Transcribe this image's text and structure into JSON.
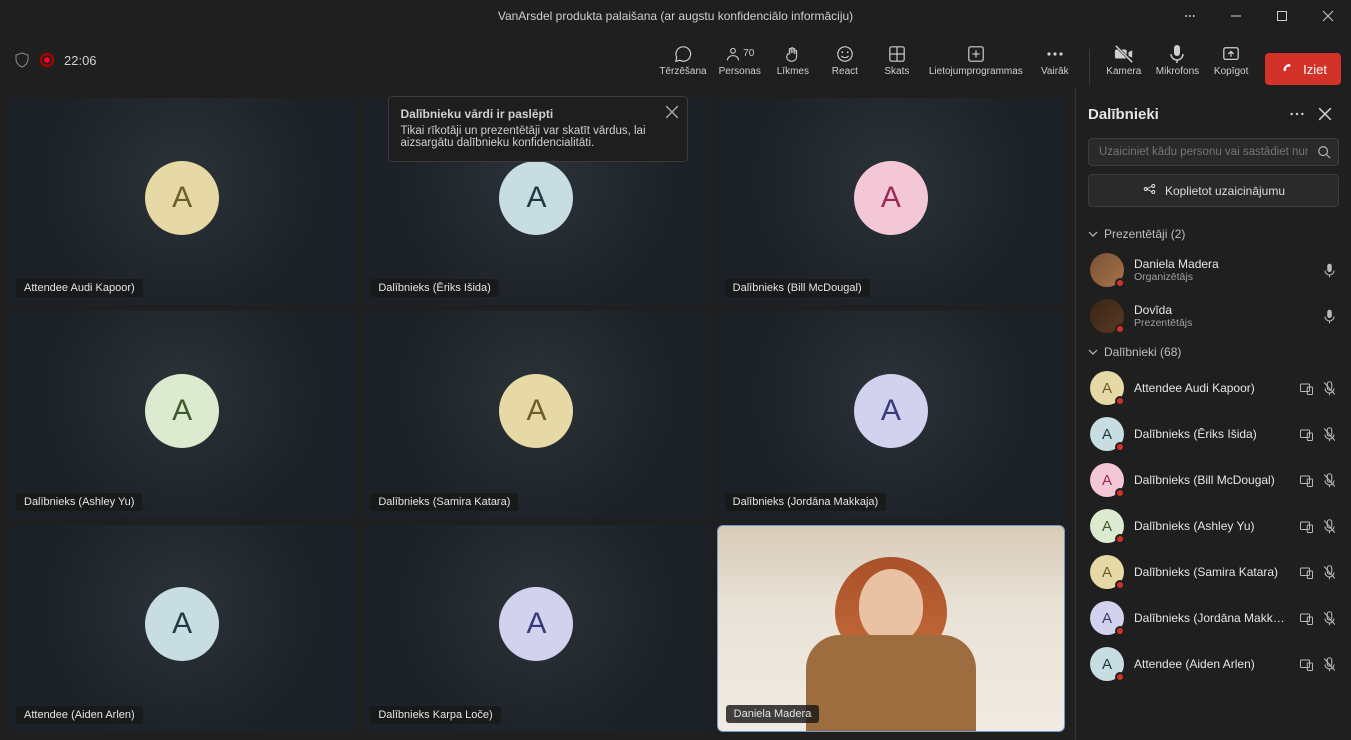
{
  "title": "VanArsdel produkta palaišana (ar augstu konfidenciālo informāciju)",
  "timer": "22:06",
  "toolbar": {
    "chat": "Tērzēšana",
    "people": "Personas",
    "people_count": "70",
    "raise": "Līkmes",
    "react": "React",
    "view": "Skats",
    "apps": "Lietojumprogrammas",
    "more": "Vairāk",
    "camera": "Kamera",
    "mic": "Mikrofons",
    "share": "Kopīgot",
    "leave": "Iziet"
  },
  "tooltip": {
    "title": "Dalībnieku vārdi ir paslēpti",
    "body": "Tikai rīkotāji un prezentētāji var skatīt vārdus, lai aizsargātu dalībnieku konfidencialitāti."
  },
  "tiles": [
    {
      "label": "Attendee Audi Kapoor)",
      "letter": "A",
      "bg": "#e7d9a5",
      "fg": "#6b5e2a"
    },
    {
      "label": "Dalībnieks (Ēriks Išida)",
      "letter": "A",
      "bg": "#c7dde1",
      "fg": "#1e3a42"
    },
    {
      "label": "Dalībnieks (Bill McDougal)",
      "letter": "A",
      "bg": "#f4c7d6",
      "fg": "#9a2a56"
    },
    {
      "label": "Dalībnieks (Ashley Yu)",
      "letter": "A",
      "bg": "#dcebd0",
      "fg": "#3e5a2a"
    },
    {
      "label": "Dalībnieks (Samira Katara)",
      "letter": "A",
      "bg": "#e7d9a5",
      "fg": "#6b5e2a"
    },
    {
      "label": "Dalībnieks (Jordāna Makkaja)",
      "letter": "A",
      "bg": "#d2d2ef",
      "fg": "#3a3a7a"
    },
    {
      "label": "Attendee (Aiden Arlen)",
      "letter": "A",
      "bg": "#c7dde1",
      "fg": "#1e3a42"
    },
    {
      "label": "Dalībnieks  Karpa Loče)",
      "letter": "A",
      "bg": "#d2d2ef",
      "fg": "#3a3a7a"
    }
  ],
  "video_tile": {
    "name": "Daniela Madera"
  },
  "panel": {
    "title": "Dalībnieki",
    "search_placeholder": "Uzaiciniet kādu personu vai sastādiet numuru",
    "share_invite": "Koplietot uzaicinājumu",
    "presenters_header": "Prezentētāji (2)",
    "presenters": [
      {
        "name": "Daniela Madera",
        "role": "Organizētājs"
      },
      {
        "name": "Dovīda",
        "role": "Prezentētājs"
      }
    ],
    "attendees_header": "Dalībnieki (68)",
    "attendees": [
      {
        "name": "Attendee Audi Kapoor)",
        "bg": "#e7d9a5",
        "fg": "#6b5e2a"
      },
      {
        "name": "Dalībnieks (Ēriks Išida)",
        "bg": "#c7dde1",
        "fg": "#1e3a42"
      },
      {
        "name": "Dalībnieks (Bill McDougal)",
        "bg": "#f4c7d6",
        "fg": "#9a2a56"
      },
      {
        "name": "Dalībnieks (Ashley Yu)",
        "bg": "#dcebd0",
        "fg": "#3e5a2a"
      },
      {
        "name": "Dalībnieks (Samira Katara)",
        "bg": "#e7d9a5",
        "fg": "#6b5e2a"
      },
      {
        "name": "Dalībnieks (Jordāna Makkaja)",
        "bg": "#d2d2ef",
        "fg": "#3a3a7a"
      },
      {
        "name": "Attendee (Aiden Arlen)",
        "bg": "#c7dde1",
        "fg": "#1e3a42"
      }
    ]
  }
}
